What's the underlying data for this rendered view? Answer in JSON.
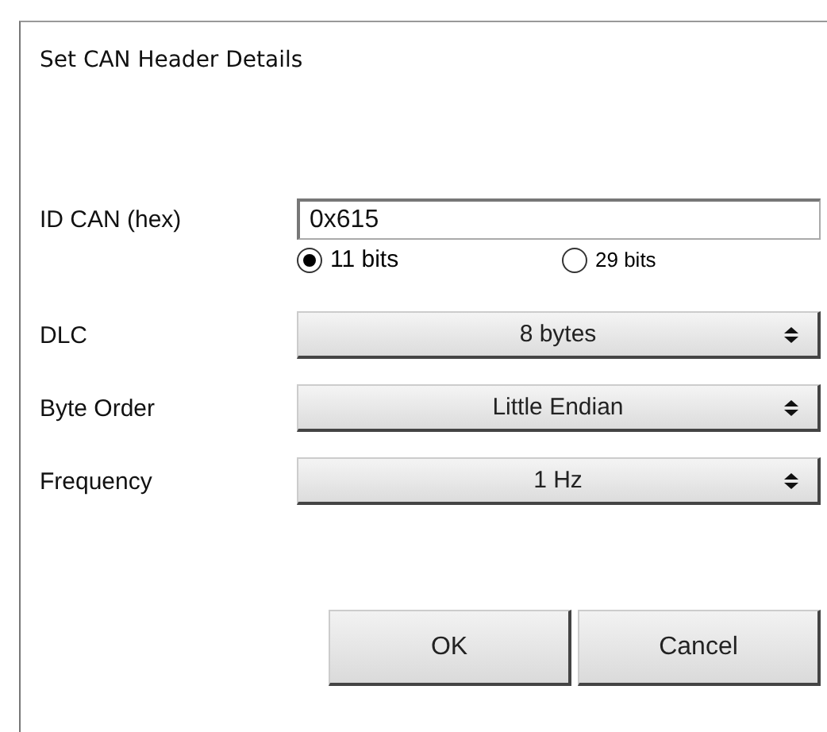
{
  "window": {
    "title": "Set CAN Header Details"
  },
  "id_field": {
    "label": "ID CAN (hex)",
    "value": "0x615"
  },
  "id_length": [
    {
      "label": "11 bits",
      "selected": true
    },
    {
      "label": "29 bits",
      "selected": false
    }
  ],
  "settings": [
    {
      "label": "DLC",
      "value": "8 bytes"
    },
    {
      "label": "Byte Order",
      "value": "Little Endian"
    },
    {
      "label": "Frequency",
      "value": "1 Hz"
    }
  ],
  "buttons": [
    "OK",
    "Cancel"
  ]
}
